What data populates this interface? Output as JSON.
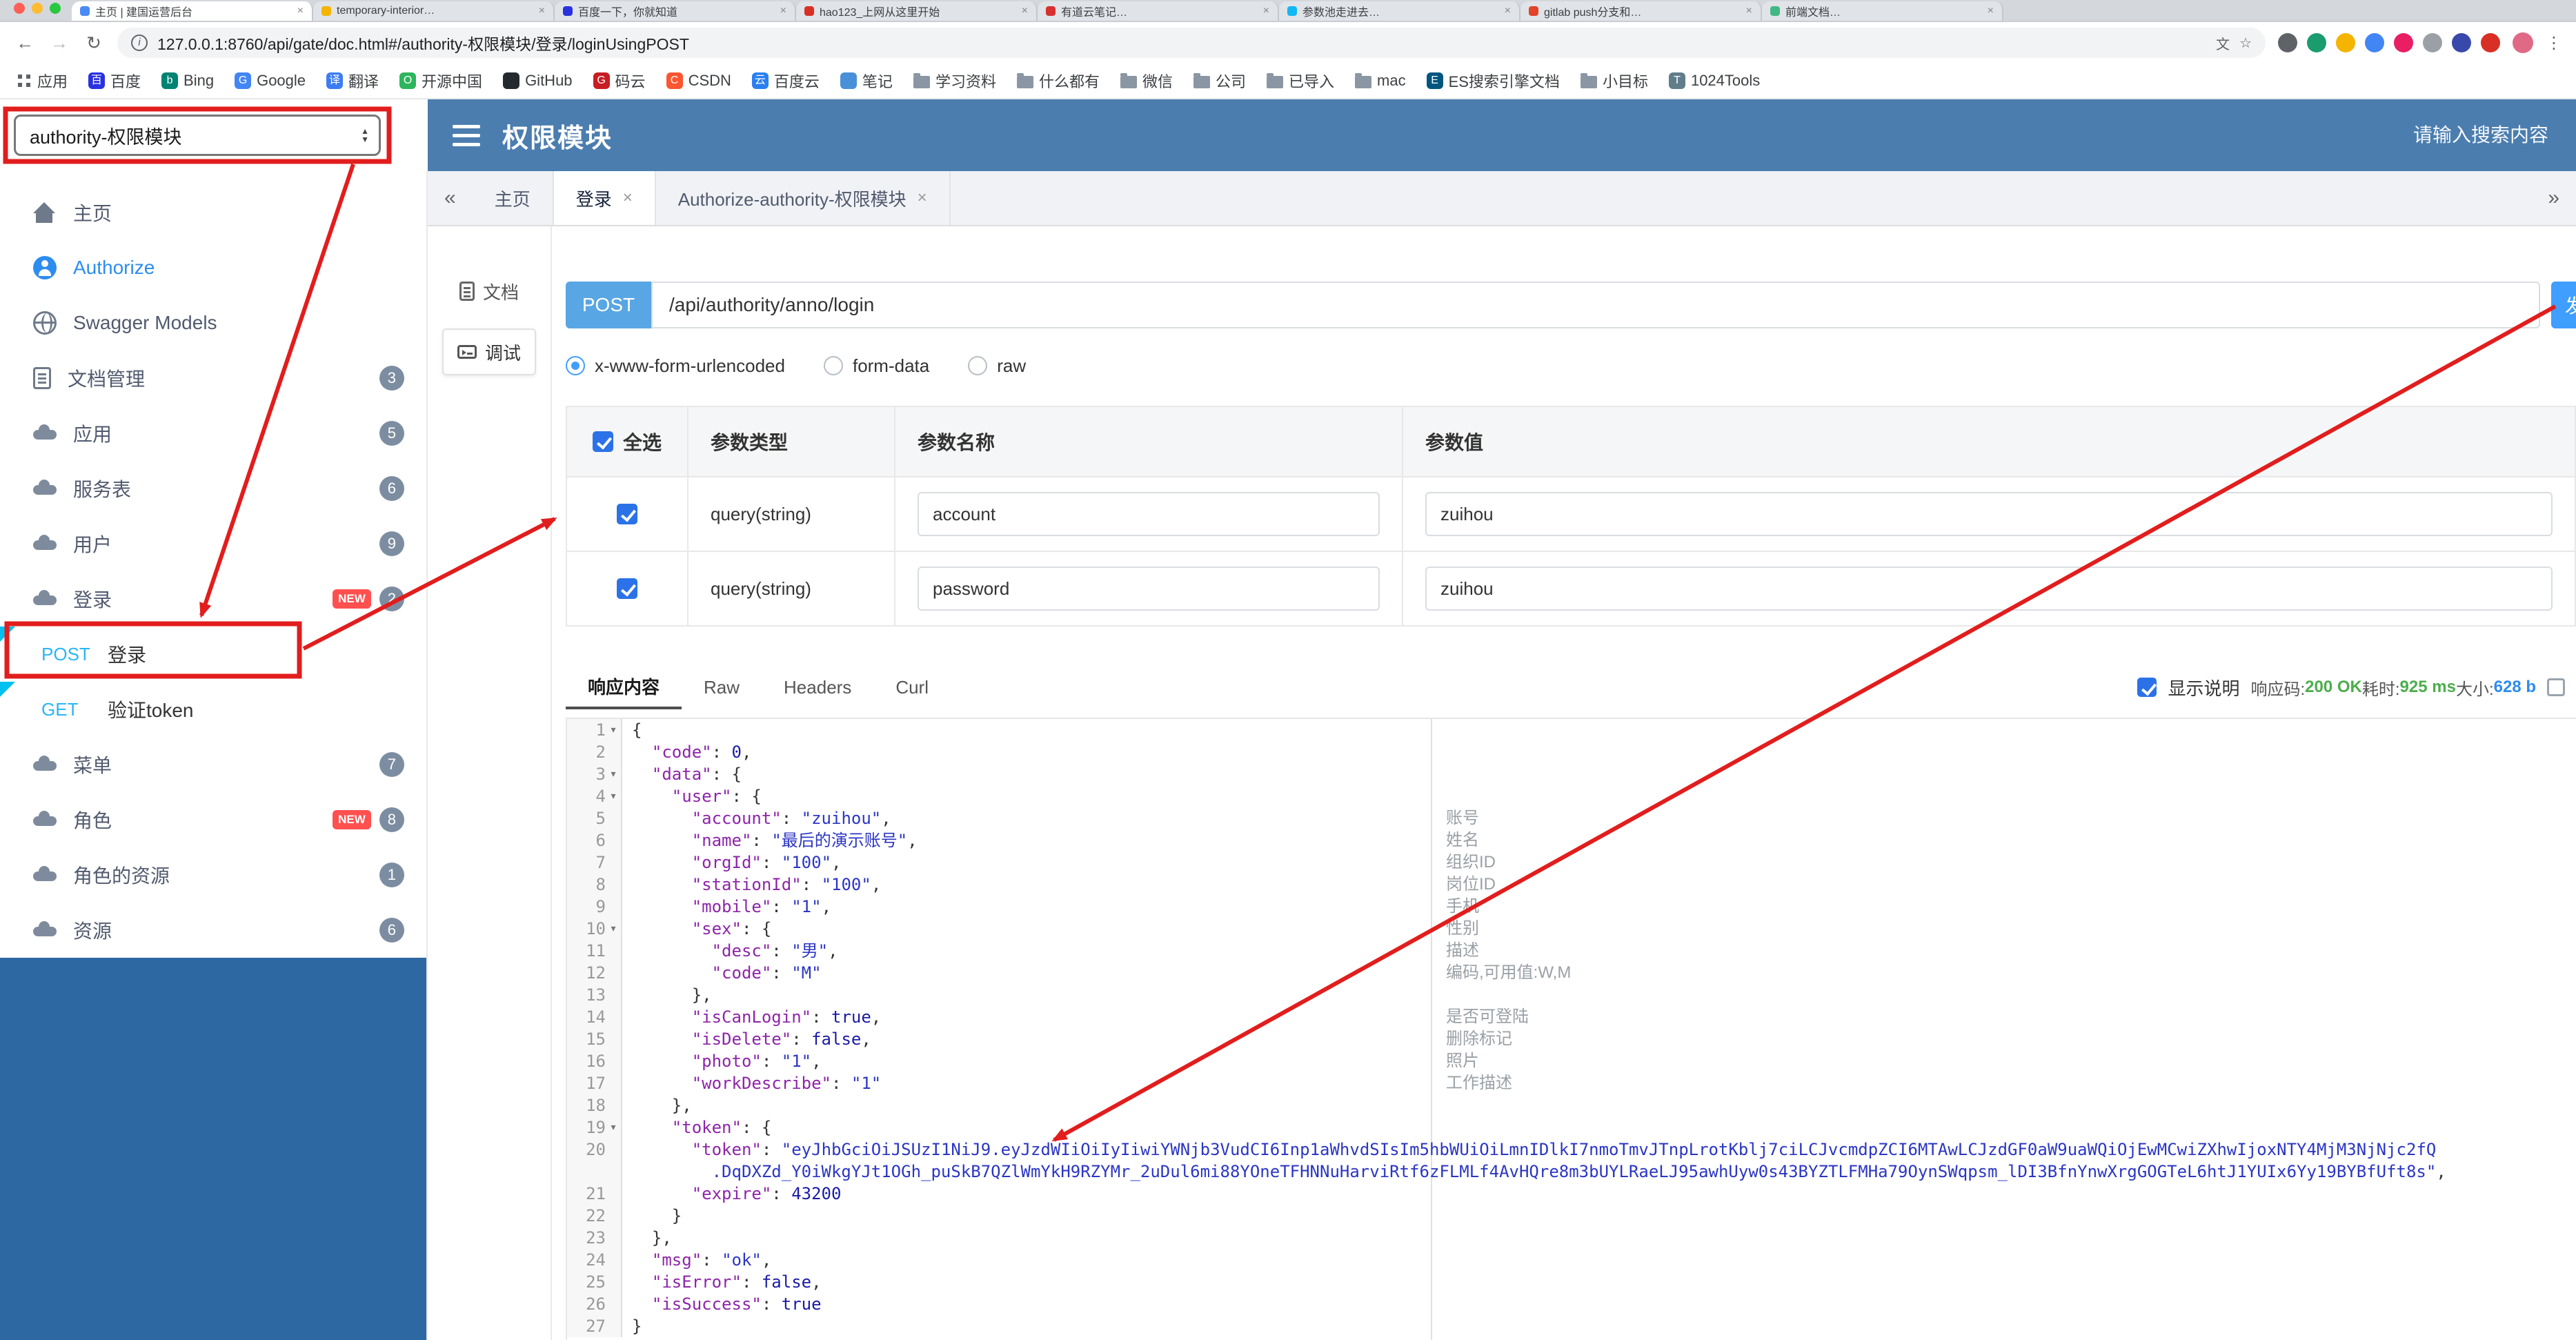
{
  "colors": {
    "header": "#4b7daf",
    "sidebar_fill": "#2e68a2",
    "accent": "#409eff",
    "method_chip": "#58a6e3",
    "method_text": "#29b6f6",
    "corner": "#00c0ef",
    "badge": "#7d8da1",
    "new_badge": "#ff5050",
    "checkbox": "#2b72e8",
    "success": "#4cae4c",
    "info_blue": "#2d8cf0",
    "annotation_red": "#e21d1d",
    "code_key": "#8e24aa",
    "code_string": "#2b36c4",
    "code_literal": "#1a1aa6"
  },
  "icons": {
    "close": "×",
    "collapse": "«",
    "expand": "»",
    "fold": "▾",
    "back": "←",
    "forward": "→",
    "reload": "↻",
    "info": "i",
    "translate": "文",
    "star": "☆",
    "menu": "⋮",
    "up": "▲",
    "down": "▼"
  },
  "browser": {
    "active_tab": 0,
    "tabs": [
      {
        "title": "主页 | 建国运营后台",
        "color": "#4a8af4"
      },
      {
        "title": "temporary-interior…",
        "color": "#f4b400"
      },
      {
        "title": "百度一下，你就知道",
        "color": "#2932e1"
      },
      {
        "title": "hao123_上网从这里开始",
        "color": "#d93025"
      },
      {
        "title": "有道云笔记…",
        "color": "#d8302f"
      },
      {
        "title": "参数池走进去…",
        "color": "#12b7f5"
      },
      {
        "title": "gitlab push分支和…",
        "color": "#e24329"
      },
      {
        "title": "前端文档…",
        "color": "#41b883"
      }
    ],
    "address": {
      "url": "127.0.0.1:8760/api/gate/doc.html#/authority-权限模块/登录/loginUsingPOST"
    },
    "extensions": [
      {
        "name": "extension-icon",
        "color": "#5f6368"
      },
      {
        "name": "extension-icon",
        "color": "#1a9c6e"
      },
      {
        "name": "extension-icon",
        "color": "#f4b400"
      },
      {
        "name": "extension-icon",
        "color": "#4285f4"
      },
      {
        "name": "extension-icon",
        "color": "#e91e63"
      },
      {
        "name": "extension-icon",
        "color": "#9aa0a6"
      },
      {
        "name": "extension-icon",
        "color": "#3949ab"
      },
      {
        "name": "extension-icon",
        "color": "#d93025"
      }
    ],
    "bookmarks": [
      {
        "label": "应用",
        "icon": "apps"
      },
      {
        "label": "百度",
        "icon": "baidu",
        "color": "#2932e1",
        "glyph": "百"
      },
      {
        "label": "Bing",
        "icon": "bing",
        "color": "#008373",
        "glyph": "b"
      },
      {
        "label": "Google",
        "icon": "google",
        "color": "#4285f4",
        "glyph": "G"
      },
      {
        "label": "翻译",
        "icon": "translate",
        "color": "#3b7cf5",
        "glyph": "译"
      },
      {
        "label": "开源中国",
        "icon": "oschina",
        "color": "#2db55d",
        "glyph": "O"
      },
      {
        "label": "GitHub",
        "icon": "github",
        "color": "#24292e",
        "glyph": ""
      },
      {
        "label": "码云",
        "icon": "gitee",
        "color": "#c71d23",
        "glyph": "G"
      },
      {
        "label": "CSDN",
        "icon": "csdn",
        "color": "#fc5531",
        "glyph": "C"
      },
      {
        "label": "百度云",
        "icon": "baiduyun",
        "color": "#2a7ff0",
        "glyph": "云"
      },
      {
        "label": "笔记",
        "icon": "note",
        "color": "#4a90d9",
        "glyph": ""
      },
      {
        "label": "学习资料",
        "icon": "folder"
      },
      {
        "label": "什么都有",
        "icon": "folder"
      },
      {
        "label": "微信",
        "icon": "folder"
      },
      {
        "label": "公司",
        "icon": "folder"
      },
      {
        "label": "已导入",
        "icon": "folder"
      },
      {
        "label": "mac",
        "icon": "folder"
      },
      {
        "label": "ES搜索引擎文档",
        "icon": "es",
        "color": "#00557f",
        "glyph": "E"
      },
      {
        "label": "小目标",
        "icon": "folder"
      },
      {
        "label": "1024Tools",
        "icon": "tools",
        "color": "#607d8b",
        "glyph": "T"
      }
    ]
  },
  "header": {
    "module_select": "authority-权限模块",
    "title": "权限模块",
    "search_placeholder": "请输入搜索内容"
  },
  "sidebar": {
    "new_badge_text": "NEW",
    "items": [
      {
        "label": "主页",
        "icon": "home"
      },
      {
        "label": "Authorize",
        "icon": "auth",
        "accent": true
      },
      {
        "label": "Swagger Models",
        "icon": "models"
      },
      {
        "label": "文档管理",
        "icon": "docs",
        "badge": "3"
      },
      {
        "label": "应用",
        "icon": "cloud",
        "badge": "5"
      },
      {
        "label": "服务表",
        "icon": "cloud",
        "badge": "6"
      },
      {
        "label": "用户",
        "icon": "cloud",
        "badge": "9"
      },
      {
        "label": "登录",
        "icon": "cloud",
        "badge": "2",
        "new": true
      },
      {
        "method": "POST",
        "label": "登录",
        "selected": true
      },
      {
        "method": "GET",
        "label": "验证token"
      },
      {
        "label": "菜单",
        "icon": "cloud",
        "badge": "7"
      },
      {
        "label": "角色",
        "icon": "cloud",
        "badge": "8",
        "new": true
      },
      {
        "label": "角色的资源",
        "icon": "cloud",
        "badge": "1"
      },
      {
        "label": "资源",
        "icon": "cloud",
        "badge": "6"
      }
    ]
  },
  "content": {
    "tabs": [
      {
        "label": "主页"
      },
      {
        "label": "登录",
        "closable": true,
        "active": true
      },
      {
        "label": "Authorize-authority-权限模块",
        "closable": true
      }
    ],
    "side_tabs": [
      {
        "label": "文档"
      },
      {
        "label": "调试",
        "active": true
      }
    ]
  },
  "request": {
    "method": "POST",
    "url": "/api/authority/anno/login",
    "send_label": "发送",
    "content_types": [
      {
        "label": "x-www-form-urlencoded",
        "selected": true
      },
      {
        "label": "form-data"
      },
      {
        "label": "raw"
      }
    ]
  },
  "params": {
    "headers": [
      "全选",
      "参数类型",
      "参数名称",
      "参数值"
    ],
    "rows": [
      {
        "checked": true,
        "type": "query(string)",
        "name": "account",
        "value": "zuihou"
      },
      {
        "checked": true,
        "type": "query(string)",
        "name": "password",
        "value": "zuihou"
      }
    ]
  },
  "response": {
    "tabs": [
      {
        "label": "响应内容",
        "active": true
      },
      {
        "label": "Raw"
      },
      {
        "label": "Headers"
      },
      {
        "label": "Curl"
      }
    ],
    "show_desc_label": "显示说明",
    "meta": {
      "code_label": "响应码:",
      "code": "200 OK",
      "time_label": "耗时:",
      "time": "925 ms",
      "size_label": "大小:",
      "size": "628 b"
    }
  },
  "code": {
    "lines": [
      {
        "no": 1,
        "fold": true,
        "tk": [
          [
            "pl",
            "{"
          ]
        ]
      },
      {
        "no": 2,
        "tk": [
          [
            "pl",
            "  "
          ],
          [
            "ky",
            "\"code\""
          ],
          [
            "pl",
            ": "
          ],
          [
            "nu",
            "0"
          ],
          [
            "pl",
            ","
          ]
        ]
      },
      {
        "no": 3,
        "fold": true,
        "tk": [
          [
            "pl",
            "  "
          ],
          [
            "ky",
            "\"data\""
          ],
          [
            "pl",
            ": {"
          ]
        ]
      },
      {
        "no": 4,
        "fold": true,
        "tk": [
          [
            "pl",
            "    "
          ],
          [
            "ky",
            "\"user\""
          ],
          [
            "pl",
            ": {"
          ]
        ]
      },
      {
        "no": 5,
        "tk": [
          [
            "pl",
            "      "
          ],
          [
            "ky",
            "\"account\""
          ],
          [
            "pl",
            ": "
          ],
          [
            "st",
            "\"zuihou\""
          ],
          [
            "pl",
            ","
          ]
        ]
      },
      {
        "no": 6,
        "tk": [
          [
            "pl",
            "      "
          ],
          [
            "ky",
            "\"name\""
          ],
          [
            "pl",
            ": "
          ],
          [
            "st",
            "\"最后的演示账号\""
          ],
          [
            "pl",
            ","
          ]
        ]
      },
      {
        "no": 7,
        "tk": [
          [
            "pl",
            "      "
          ],
          [
            "ky",
            "\"orgId\""
          ],
          [
            "pl",
            ": "
          ],
          [
            "st",
            "\"100\""
          ],
          [
            "pl",
            ","
          ]
        ]
      },
      {
        "no": 8,
        "tk": [
          [
            "pl",
            "      "
          ],
          [
            "ky",
            "\"stationId\""
          ],
          [
            "pl",
            ": "
          ],
          [
            "st",
            "\"100\""
          ],
          [
            "pl",
            ","
          ]
        ]
      },
      {
        "no": 9,
        "tk": [
          [
            "pl",
            "      "
          ],
          [
            "ky",
            "\"mobile\""
          ],
          [
            "pl",
            ": "
          ],
          [
            "st",
            "\"1\""
          ],
          [
            "pl",
            ","
          ]
        ]
      },
      {
        "no": 10,
        "fold": true,
        "tk": [
          [
            "pl",
            "      "
          ],
          [
            "ky",
            "\"sex\""
          ],
          [
            "pl",
            ": {"
          ]
        ]
      },
      {
        "no": 11,
        "tk": [
          [
            "pl",
            "        "
          ],
          [
            "ky",
            "\"desc\""
          ],
          [
            "pl",
            ": "
          ],
          [
            "st",
            "\"男\""
          ],
          [
            "pl",
            ","
          ]
        ]
      },
      {
        "no": 12,
        "tk": [
          [
            "pl",
            "        "
          ],
          [
            "ky",
            "\"code\""
          ],
          [
            "pl",
            ": "
          ],
          [
            "st",
            "\"M\""
          ]
        ]
      },
      {
        "no": 13,
        "tk": [
          [
            "pl",
            "      },"
          ]
        ]
      },
      {
        "no": 14,
        "tk": [
          [
            "pl",
            "      "
          ],
          [
            "ky",
            "\"isCanLogin\""
          ],
          [
            "pl",
            ": "
          ],
          [
            "bo",
            "true"
          ],
          [
            "pl",
            ","
          ]
        ]
      },
      {
        "no": 15,
        "tk": [
          [
            "pl",
            "      "
          ],
          [
            "ky",
            "\"isDelete\""
          ],
          [
            "pl",
            ": "
          ],
          [
            "bo",
            "false"
          ],
          [
            "pl",
            ","
          ]
        ]
      },
      {
        "no": 16,
        "tk": [
          [
            "pl",
            "      "
          ],
          [
            "ky",
            "\"photo\""
          ],
          [
            "pl",
            ": "
          ],
          [
            "st",
            "\"1\""
          ],
          [
            "pl",
            ","
          ]
        ]
      },
      {
        "no": 17,
        "tk": [
          [
            "pl",
            "      "
          ],
          [
            "ky",
            "\"workDescribe\""
          ],
          [
            "pl",
            ": "
          ],
          [
            "st",
            "\"1\""
          ]
        ]
      },
      {
        "no": 18,
        "tk": [
          [
            "pl",
            "    },"
          ]
        ]
      },
      {
        "no": 19,
        "fold": true,
        "tk": [
          [
            "pl",
            "    "
          ],
          [
            "ky",
            "\"token\""
          ],
          [
            "pl",
            ": {"
          ]
        ]
      },
      {
        "no": 20,
        "tk": [
          [
            "pl",
            "      "
          ],
          [
            "ky",
            "\"token\""
          ],
          [
            "pl",
            ": "
          ],
          [
            "st",
            "\"eyJhbGciOiJSUzI1NiJ9.eyJzdWIiOiIyIiwiYWNjb3VudCI6Inp1aWhvdSIsIm5hbWUiOiLmnIDlkI7nmoTmvJTnpLrotKblj7ciLCJvcmdpZCI6MTAwLCJzdGF0aW9uaWQiOjEwMCwiZXhwIjoxNTY4MjM3NjNjc2fQ\n        .DqDXZd_Y0iWkgYJt1OGh_puSkB7QZlWmYkH9RZYMr_2uDul6mi88YOneTFHNNuHarviRtf6zFLMLf4AvHQre8m3bUYLRaeLJ95awhUyw0s43BYZTLFMHa79OynSWqpsm_lDI3BfnYnwXrgGOGTeL6htJ1YUIx6Yy19BYBfUft8s\""
          ],
          [
            "pl",
            ","
          ]
        ]
      },
      {
        "no": 21,
        "tk": [
          [
            "pl",
            "      "
          ],
          [
            "ky",
            "\"expire\""
          ],
          [
            "pl",
            ": "
          ],
          [
            "nu",
            "43200"
          ]
        ]
      },
      {
        "no": 22,
        "tk": [
          [
            "pl",
            "    }"
          ]
        ]
      },
      {
        "no": 23,
        "tk": [
          [
            "pl",
            "  },"
          ]
        ]
      },
      {
        "no": 24,
        "tk": [
          [
            "pl",
            "  "
          ],
          [
            "ky",
            "\"msg\""
          ],
          [
            "pl",
            ": "
          ],
          [
            "st",
            "\"ok\""
          ],
          [
            "pl",
            ","
          ]
        ]
      },
      {
        "no": 25,
        "tk": [
          [
            "pl",
            "  "
          ],
          [
            "ky",
            "\"isError\""
          ],
          [
            "pl",
            ": "
          ],
          [
            "bo",
            "false"
          ],
          [
            "pl",
            ","
          ]
        ]
      },
      {
        "no": 26,
        "tk": [
          [
            "pl",
            "  "
          ],
          [
            "ky",
            "\"isSuccess\""
          ],
          [
            "pl",
            ": "
          ],
          [
            "bo",
            "true"
          ]
        ]
      },
      {
        "no": 27,
        "tk": [
          [
            "pl",
            "}"
          ]
        ]
      }
    ],
    "annotations": [
      "",
      "",
      "",
      "",
      "账号",
      "姓名",
      "组织ID",
      "岗位ID",
      "手机",
      "性别",
      "描述",
      "编码,可用值:W,M",
      "",
      "是否可登陆",
      "删除标记",
      "照片",
      "工作描述"
    ]
  }
}
